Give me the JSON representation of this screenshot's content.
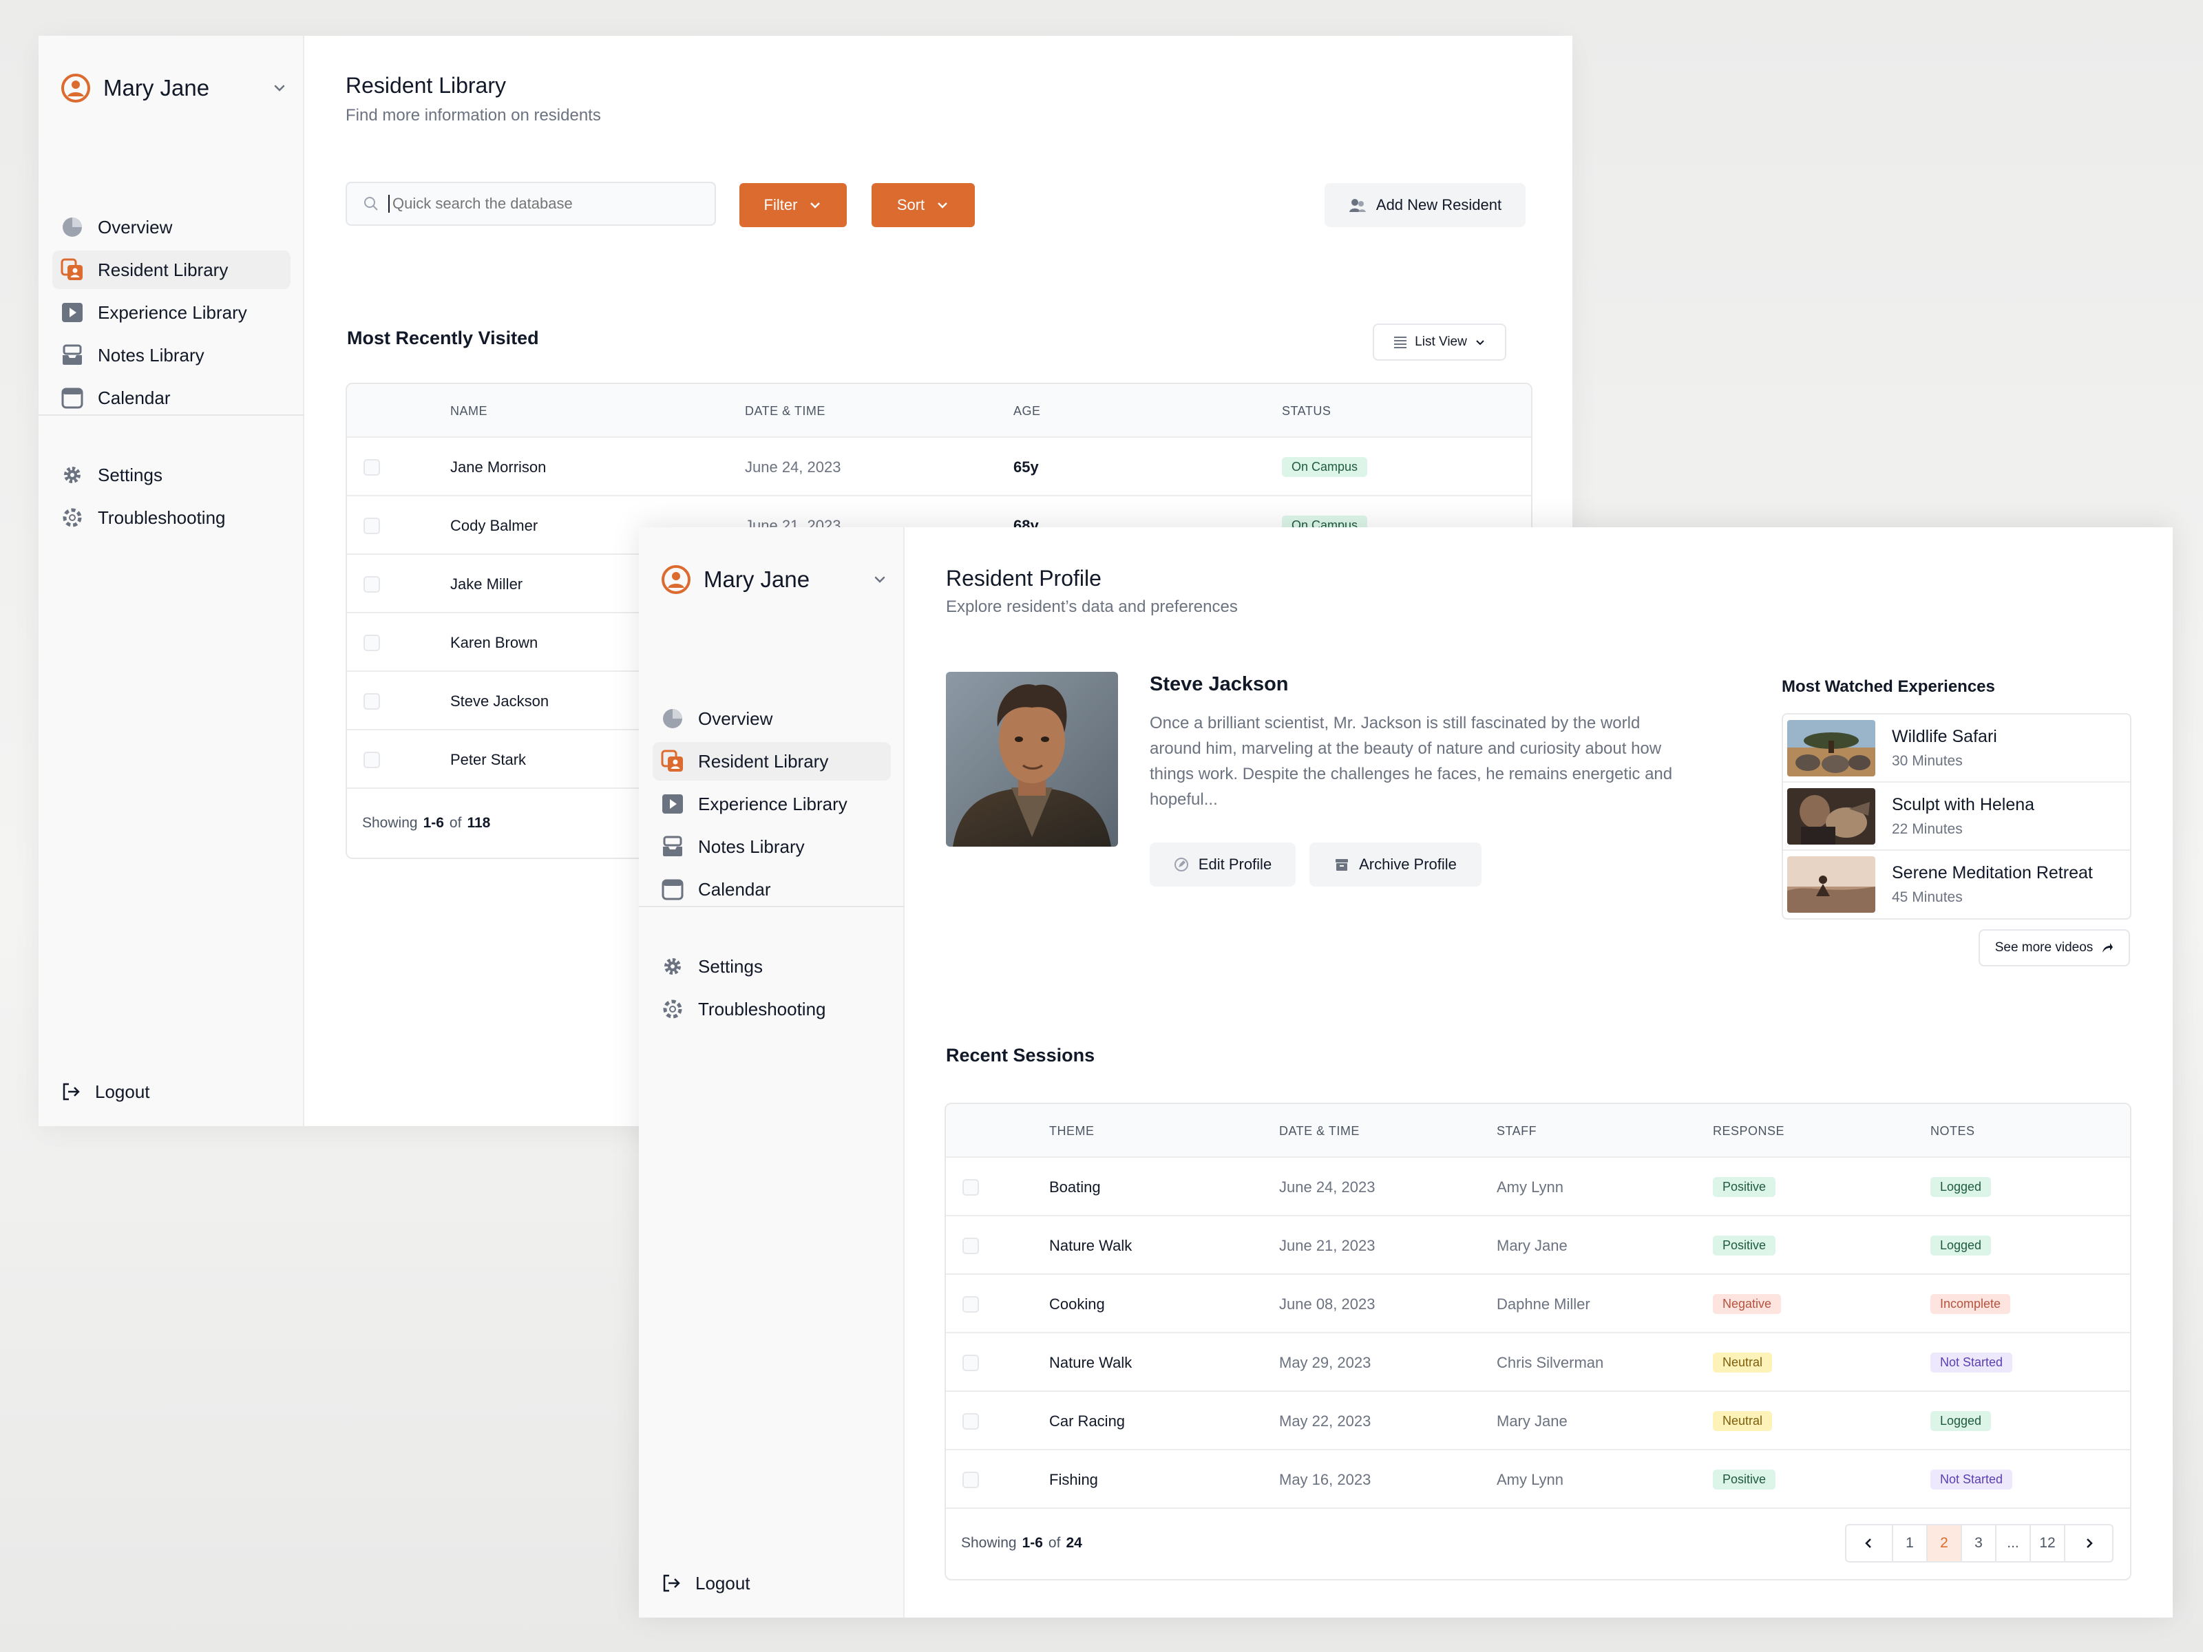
{
  "colors": {
    "accent": "#dc6b2f",
    "positive": "#ddf5e9",
    "negative": "#fde4de",
    "neutral": "#fdf3b8",
    "not_started": "#ede8fb"
  },
  "sidebar": {
    "user_name": "Mary Jane",
    "items": [
      {
        "label": "Overview",
        "icon": "pie-chart-icon"
      },
      {
        "label": "Resident Library",
        "icon": "resident-library-icon",
        "active": true
      },
      {
        "label": "Experience Library",
        "icon": "play-icon"
      },
      {
        "label": "Notes Library",
        "icon": "inbox-icon"
      },
      {
        "label": "Calendar",
        "icon": "calendar-icon"
      }
    ],
    "secondary": [
      {
        "label": "Settings",
        "icon": "gear-icon"
      },
      {
        "label": "Troubleshooting",
        "icon": "lifebuoy-icon"
      }
    ],
    "logout": "Logout"
  },
  "library": {
    "title": "Resident Library",
    "subtitle": "Find more information on residents",
    "search_placeholder": "Quick search the database",
    "filter_label": "Filter",
    "sort_label": "Sort",
    "add_label": "Add New Resident",
    "section_title": "Most Recently Visited",
    "view_label": "List View",
    "columns": [
      "NAME",
      "DATE & TIME",
      "AGE",
      "STATUS"
    ],
    "rows": [
      {
        "name": "Jane Morrison",
        "date": "June 24, 2023",
        "age": "65y",
        "status": "On Campus"
      },
      {
        "name": "Cody Balmer",
        "date": "June 21, 2023",
        "age": "68y",
        "status": "On Campus"
      },
      {
        "name": "Jake Miller"
      },
      {
        "name": "Karen Brown"
      },
      {
        "name": "Steve Jackson"
      },
      {
        "name": "Peter Stark"
      }
    ],
    "showing_prefix": "Showing",
    "showing_range": "1-6",
    "showing_of": "of",
    "showing_total": "118"
  },
  "profile": {
    "title": "Resident Profile",
    "subtitle": "Explore resident’s data and preferences",
    "name": "Steve Jackson",
    "bio": "Once a brilliant scientist, Mr. Jackson is still fascinated by the world around him, marveling at the beauty of nature and curiosity about how things work. Despite the challenges he faces, he remains energetic and hopeful...",
    "edit_label": "Edit Profile",
    "archive_label": "Archive Profile",
    "most_watched_title": "Most Watched Experiences",
    "most_watched": [
      {
        "name": "Wildlife Safari",
        "duration": "30 Minutes"
      },
      {
        "name": "Sculpt with Helena",
        "duration": "22 Minutes"
      },
      {
        "name": "Serene Meditation Retreat",
        "duration": "45 Minutes"
      }
    ],
    "see_more_label": "See more videos"
  },
  "sessions": {
    "title": "Recent Sessions",
    "columns": [
      "THEME",
      "DATE & TIME",
      "STAFF",
      "RESPONSE",
      "NOTES"
    ],
    "rows": [
      {
        "theme": "Boating",
        "date": "June 24, 2023",
        "staff": "Amy Lynn",
        "response": "Positive",
        "notes": "Logged"
      },
      {
        "theme": "Nature Walk",
        "date": "June 21, 2023",
        "staff": "Mary Jane",
        "response": "Positive",
        "notes": "Logged"
      },
      {
        "theme": "Cooking",
        "date": "June 08, 2023",
        "staff": "Daphne Miller",
        "response": "Negative",
        "notes": "Incomplete"
      },
      {
        "theme": "Nature Walk",
        "date": "May 29, 2023",
        "staff": "Chris Silverman",
        "response": "Neutral",
        "notes": "Not Started"
      },
      {
        "theme": "Car Racing",
        "date": "May 22, 2023",
        "staff": "Mary Jane",
        "response": "Neutral",
        "notes": "Logged"
      },
      {
        "theme": "Fishing",
        "date": "May 16, 2023",
        "staff": "Amy Lynn",
        "response": "Positive",
        "notes": "Not Started"
      }
    ],
    "showing_prefix": "Showing",
    "showing_range": "1-6",
    "showing_of": "of",
    "showing_total": "24",
    "pages": [
      "1",
      "2",
      "3",
      "...",
      "12"
    ],
    "current_page": "2"
  }
}
